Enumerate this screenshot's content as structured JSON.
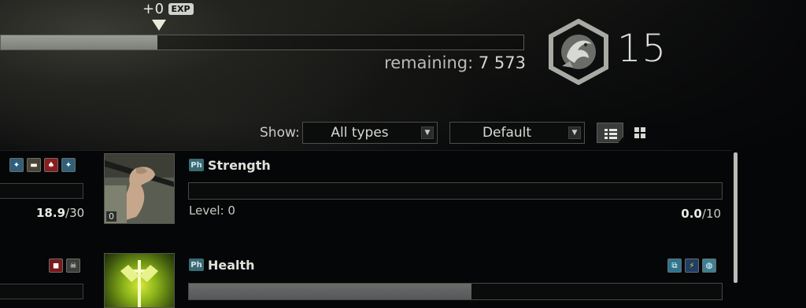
{
  "xp": {
    "gain": "+0",
    "badge": "EXP",
    "fill_fraction": 0.3,
    "remaining_label": "remaining:",
    "remaining_value": "7 573"
  },
  "level": {
    "value": "15"
  },
  "filter": {
    "show_label": "Show:",
    "type_select": "All types",
    "sort_select": "Default"
  },
  "left_column": {
    "row1_value": "18.9",
    "row1_max": "/30"
  },
  "skills": [
    {
      "tag": "Ph",
      "name": "Strength",
      "level_label": "Level: 0",
      "portrait_level": "0",
      "progress": "0.0",
      "max": "/10",
      "fill_fraction": 0.0
    },
    {
      "tag": "Ph",
      "name": "Health",
      "fill_fraction": 0.53
    }
  ],
  "colors": {
    "accent_teal": "#3a6a74",
    "xp_fill": "#8b8d87",
    "background": "#050607"
  }
}
